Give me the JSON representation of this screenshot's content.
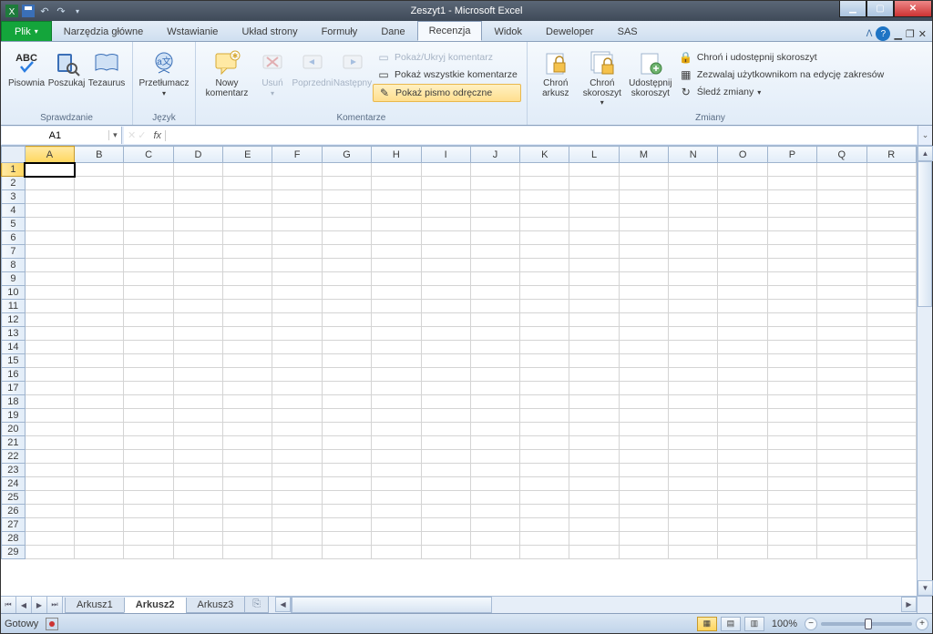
{
  "title": "Zeszyt1  -  Microsoft Excel",
  "qat": {
    "undo": "↶",
    "redo": "↷"
  },
  "tabs": {
    "file": "Plik",
    "items": [
      "Narzędzia główne",
      "Wstawianie",
      "Układ strony",
      "Formuły",
      "Dane",
      "Recenzja",
      "Widok",
      "Deweloper",
      "SAS"
    ],
    "active_index": 5
  },
  "ribbon": {
    "g1": {
      "label": "Sprawdzanie",
      "btns": [
        {
          "label": "Pisownia"
        },
        {
          "label": "Poszukaj"
        },
        {
          "label": "Tezaurus"
        }
      ]
    },
    "g2": {
      "label": "Język",
      "btn": {
        "label": "Przetłumacz"
      }
    },
    "g3": {
      "label": "Komentarze",
      "big": [
        {
          "label": "Nowy\nkomentarz"
        },
        {
          "label": "Usuń"
        },
        {
          "label": "Poprzedni"
        },
        {
          "label": "Następny"
        }
      ],
      "small": [
        {
          "label": "Pokaż/Ukryj komentarz"
        },
        {
          "label": "Pokaż wszystkie komentarze"
        },
        {
          "label": "Pokaż pismo odręczne"
        }
      ]
    },
    "g4": {
      "label": "Zmiany",
      "big": [
        {
          "label": "Chroń\narkusz"
        },
        {
          "label": "Chroń\nskoroszyt"
        },
        {
          "label": "Udostępnij\nskoroszyt"
        }
      ],
      "small": [
        {
          "label": "Chroń i udostępnij skoroszyt"
        },
        {
          "label": "Zezwalaj użytkownikom na edycję zakresów"
        },
        {
          "label": "Śledź zmiany"
        }
      ]
    }
  },
  "namebox": "A1",
  "fx": "",
  "columns": [
    "A",
    "B",
    "C",
    "D",
    "E",
    "F",
    "G",
    "H",
    "I",
    "J",
    "K",
    "L",
    "M",
    "N",
    "O",
    "P",
    "Q",
    "R"
  ],
  "rows": [
    1,
    2,
    3,
    4,
    5,
    6,
    7,
    8,
    9,
    10,
    11,
    12,
    13,
    14,
    15,
    16,
    17,
    18,
    19,
    20,
    21,
    22,
    23,
    24,
    25,
    26,
    27,
    28,
    29
  ],
  "selected": {
    "col": "A",
    "row": 1
  },
  "sheets": {
    "items": [
      "Arkusz1",
      "Arkusz2",
      "Arkusz3"
    ],
    "active_index": 1
  },
  "status": {
    "ready": "Gotowy",
    "zoom": "100%"
  }
}
